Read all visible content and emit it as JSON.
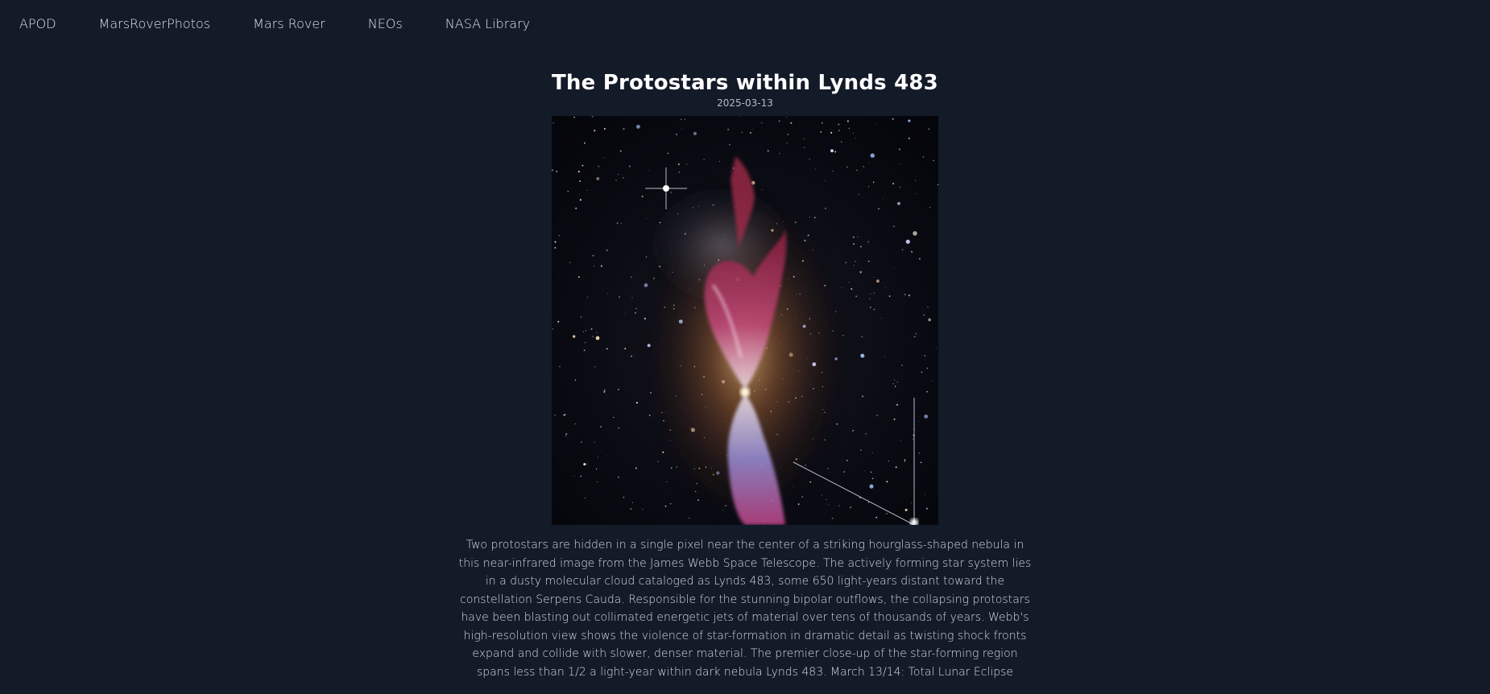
{
  "nav": {
    "items": [
      {
        "label": "APOD"
      },
      {
        "label": "MarsRoverPhotos"
      },
      {
        "label": "Mars Rover"
      },
      {
        "label": "NEOs"
      },
      {
        "label": "NASA Library"
      }
    ]
  },
  "apod": {
    "title": "The Protostars within Lynds 483",
    "date": "2025-03-13",
    "explanation": "Two protostars are hidden in a single pixel near the center of a striking hourglass-shaped nebula in this near-infrared image from the James Webb Space Telescope. The actively forming star system lies in a dusty molecular cloud cataloged as Lynds 483, some 650 light-years distant toward the constellation Serpens Cauda. Responsible for the stunning bipolar outflows, the collapsing protostars have been blasting out collimated energetic jets of material over tens of thousands of years. Webb's high-resolution view shows the violence of star-formation in dramatic detail as twisting shock fronts expand and collide with slower, denser material. The premier close-up of the star-forming region spans less than 1/2 a light-year within dark nebula Lynds 483. March 13/14: Total Lunar Eclipse"
  },
  "colors": {
    "background": "#131a28",
    "nav_text": "#dfe3ea",
    "title_text": "#ffffff",
    "date_text": "#b6bcc8"
  }
}
